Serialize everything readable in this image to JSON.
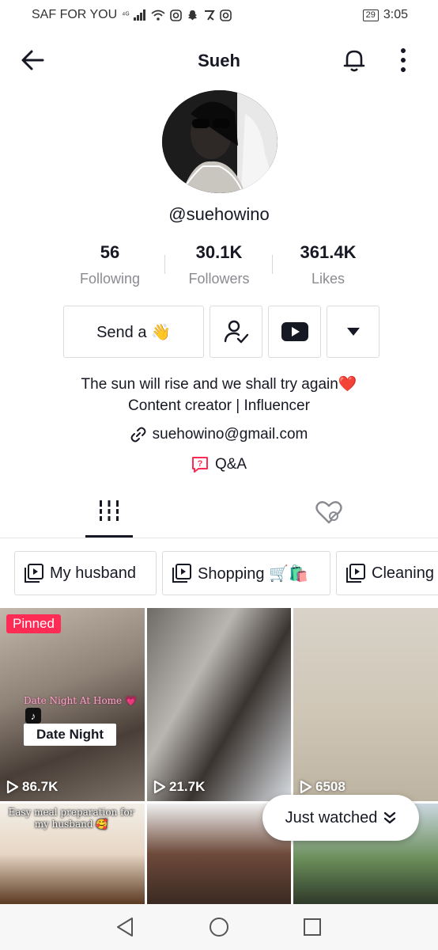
{
  "status_bar": {
    "carrier": "SAF FOR YOU",
    "signal": "⁴ᴳ",
    "battery": "29",
    "time": "3:05"
  },
  "header": {
    "title": "Sueh"
  },
  "profile": {
    "username": "@suehowino",
    "stats": [
      {
        "value": "56",
        "label": "Following"
      },
      {
        "value": "30.1K",
        "label": "Followers"
      },
      {
        "value": "361.4K",
        "label": "Likes"
      }
    ],
    "send_button": "Send a 👋",
    "bio_line1": "The sun will rise and we shall try again❤️",
    "bio_line2": "Content creator | Influencer",
    "email": "suehowino@gmail.com",
    "qa_label": "Q&A"
  },
  "playlists": [
    {
      "label": "My husband"
    },
    {
      "label": "Shopping 🛒🛍️"
    },
    {
      "label": "Cleaning"
    }
  ],
  "videos": [
    {
      "views": "86.7K",
      "pinned_label": "Pinned",
      "overlay_text": "Date Night At Home 💗",
      "caption": "Date Night"
    },
    {
      "views": "21.7K"
    },
    {
      "views": "6508"
    },
    {
      "overlay_text": "Easy meal preparation for my husband 🥰"
    },
    {},
    {}
  ],
  "just_watched": "Just watched",
  "colors": {
    "accent": "#fe2c55",
    "text": "#161823",
    "muted": "#8a8b91"
  }
}
